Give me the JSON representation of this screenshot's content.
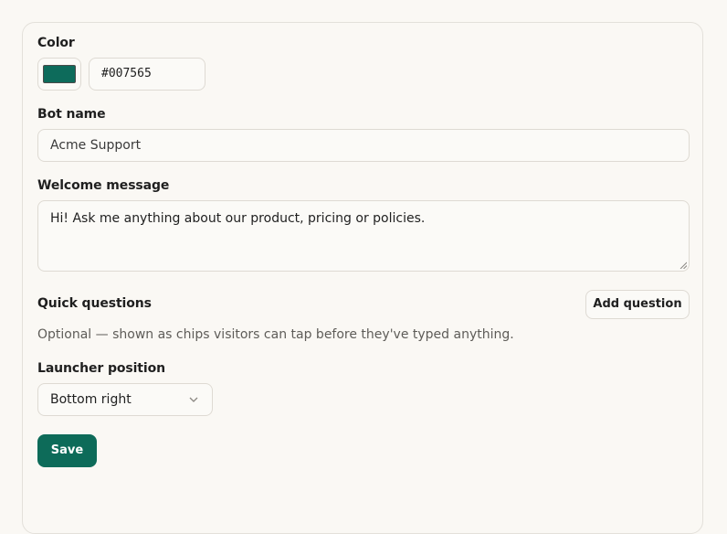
{
  "color": {
    "label": "Color",
    "value": "#007565",
    "swatch_hex": "#0d6b5b"
  },
  "bot_name": {
    "label": "Bot name",
    "value": "Acme Support"
  },
  "welcome": {
    "label": "Welcome message",
    "value": "Hi! Ask me anything about our product, pricing or policies."
  },
  "quick_questions": {
    "label": "Quick questions",
    "add_button": "Add question",
    "help": "Optional — shown as chips visitors can tap before they've typed anything."
  },
  "launcher": {
    "label": "Launcher position",
    "selected": "Bottom right"
  },
  "actions": {
    "save_label": "Save"
  },
  "theme": {
    "accent": "#0d6b59",
    "background": "#faf8f4",
    "border": "#dedad3"
  }
}
